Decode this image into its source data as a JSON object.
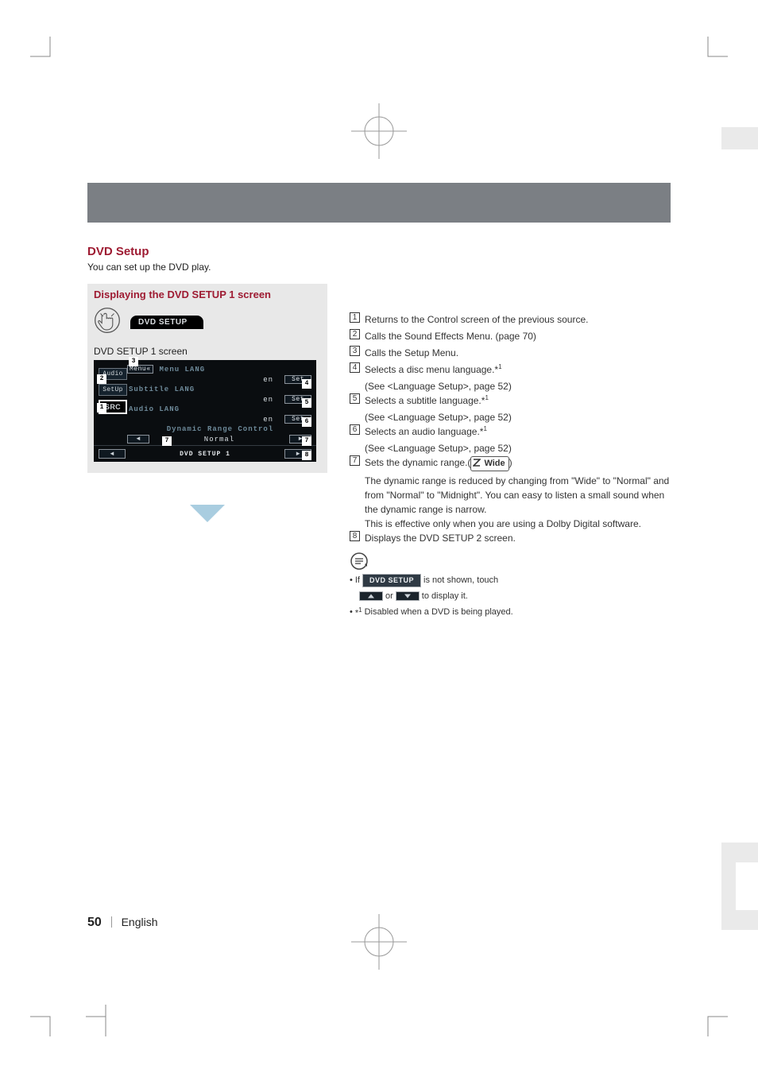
{
  "section": {
    "title": "DVD Setup",
    "subtitle": "You can set up the DVD play."
  },
  "panel": {
    "title": "Displaying the DVD SETUP 1 screen",
    "tab_label": "DVD SETUP",
    "caption": "DVD SETUP 1 screen"
  },
  "screen": {
    "side": {
      "audio": "Audio",
      "setup": "SetUp",
      "src": "SRC"
    },
    "menu_btn": "Menu",
    "rows": {
      "menu_lang": "Menu LANG",
      "subtitle_lang": "Subtitle  LANG",
      "audio_lang": "Audio  LANG",
      "range_ctrl": "Dynamic  Range  Control",
      "value_en": "en",
      "value_normal": "Normal",
      "set": "Set"
    },
    "footer_title": "DVD SETUP 1"
  },
  "list": {
    "i1": "Returns to the Control screen of the previous source.",
    "i2": "Calls the Sound Effects Menu. (page 70)",
    "i3": "Calls the Setup Menu.",
    "i4a": "Selects a disc menu language.*",
    "i4b": "(See <Language Setup>, page 52)",
    "i5a": "Selects a subtitle language.*",
    "i5b": "(See <Language Setup>, page 52)",
    "i6a": "Selects an audio language.*",
    "i6b": "(See <Language Setup>, page 52)",
    "i7a": "Sets the dynamic range.(",
    "i7def": "Wide",
    "i7close": ")",
    "i7b": "The dynamic range is reduced by changing from \"Wide\" to \"Normal\" and from \"Normal\" to \"Midnight\". You can easy to listen a small sound when the dynamic range is narrow.",
    "i7c": "This is effective only when you are using a Dolby Digital software.",
    "i8": "Displays the DVD SETUP 2 screen."
  },
  "notes": {
    "n1a": "If",
    "n1b": "DVD SETUP",
    "n1c": "is not shown, touch",
    "n1d": "or",
    "n1e": "to display it.",
    "n2": "Disabled when a DVD is being played."
  },
  "footer": {
    "page": "50",
    "lang": "English"
  },
  "callouts": {
    "c1": "1",
    "c2": "2",
    "c3": "3",
    "c4": "4",
    "c5": "5",
    "c6": "6",
    "c7": "7",
    "c8": "8"
  }
}
